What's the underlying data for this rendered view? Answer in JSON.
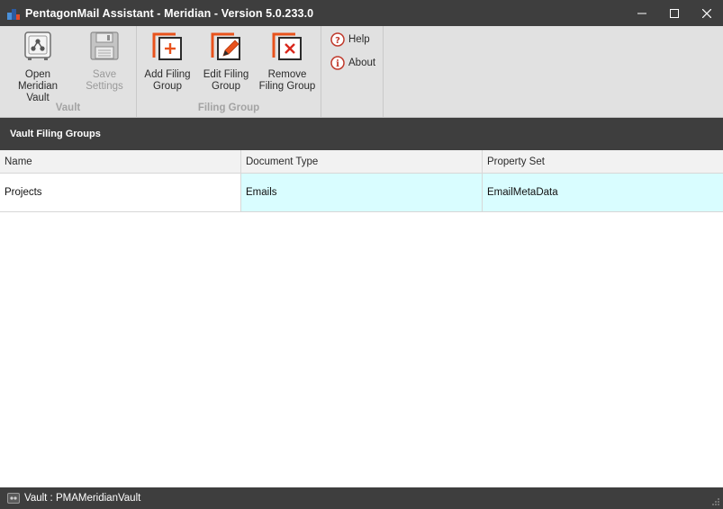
{
  "window": {
    "title": "PentagonMail Assistant - Meridian - Version 5.0.233.0"
  },
  "ribbon": {
    "vault_group": {
      "label": "Vault",
      "open_vault": "Open Meridian\nVault",
      "save_settings": "Save\nSettings"
    },
    "filing_group": {
      "label": "Filing Group",
      "add": "Add Filing\nGroup",
      "edit": "Edit Filing\nGroup",
      "remove": "Remove\nFiling Group"
    },
    "help_group": {
      "help": "Help",
      "about": "About"
    }
  },
  "section": {
    "title": "Vault Filing Groups"
  },
  "grid": {
    "columns": [
      "Name",
      "Document Type",
      "Property Set"
    ],
    "rows": [
      [
        "Projects",
        "Emails",
        "EmailMetaData"
      ]
    ]
  },
  "status": {
    "text": "Vault : PMAMeridianVault"
  },
  "colors": {
    "title_bar": "#3e3e3e",
    "ribbon_bg": "#e1e1e1",
    "accent_orange": "#e8521c",
    "row_highlight": "#d9fdff"
  }
}
